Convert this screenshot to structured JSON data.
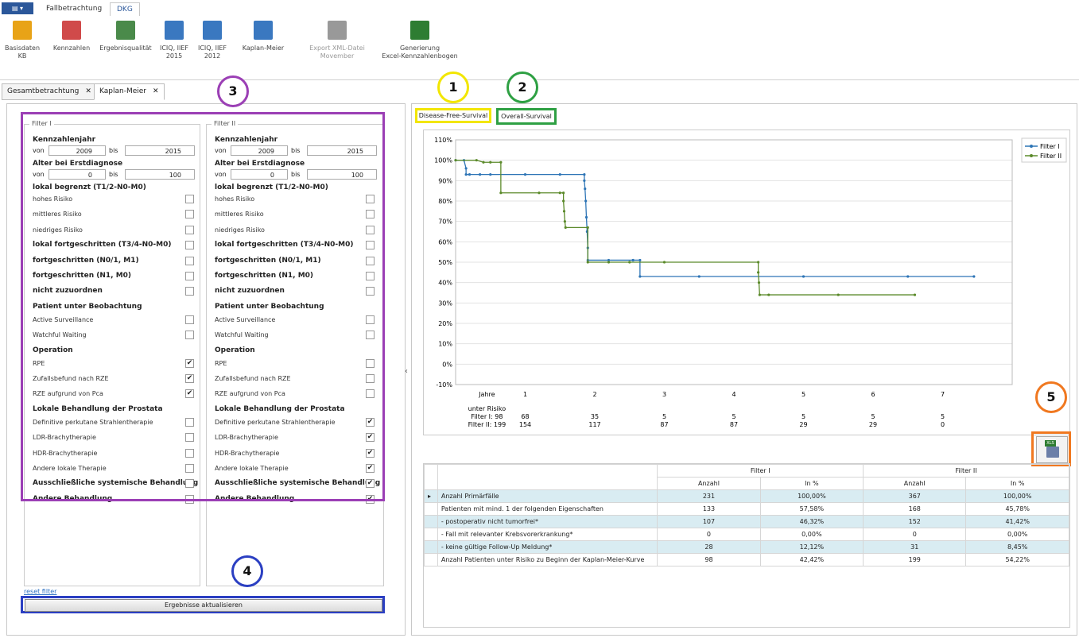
{
  "app": {
    "menu_button": "▤ ▾",
    "tabs": [
      "Fallbetrachtung",
      "DKG"
    ],
    "active_tab": "DKG"
  },
  "ribbon": {
    "buttons": [
      {
        "label": "Basisdaten\nKB",
        "icon": "database-icon",
        "color": "#e8a317"
      },
      {
        "label": "Kennzahlen",
        "icon": "grid-icon",
        "color": "#d04a4a"
      },
      {
        "label": "Ergebnisqualität",
        "icon": "checklist-icon",
        "color": "#4a8a4a"
      },
      {
        "label": "ICIQ, IIEF\n2015",
        "icon": "help-doc-icon",
        "color": "#3a78c0"
      },
      {
        "label": "ICIQ, IIEF\n2012",
        "icon": "help-doc-icon",
        "color": "#3a78c0"
      },
      {
        "label": "Kaplan-Meier",
        "icon": "line-chart-icon",
        "color": "#3a78c0"
      },
      {
        "label": "Export XML-Datei\nMovember",
        "icon": "xml-save-icon",
        "color": "#999999"
      },
      {
        "label": "Generierung\nExcel-Kennzahlenbogen",
        "icon": "excel-save-icon",
        "color": "#2e7d32"
      }
    ]
  },
  "doc_tabs": [
    {
      "label": "Gesamtbetrachtung",
      "close": "✕"
    },
    {
      "label": "Kaplan-Meier",
      "close": "✕"
    }
  ],
  "filters": {
    "filter1": {
      "legend": "Filter I",
      "year_from": "2009",
      "year_to": "2015",
      "age_from": "0",
      "age_to": "100",
      "checks": [
        false,
        false,
        false,
        false,
        false,
        false,
        false,
        false,
        false,
        true,
        true,
        true,
        false,
        false,
        false,
        false,
        false,
        false
      ]
    },
    "filter2": {
      "legend": "Filter II",
      "year_from": "2009",
      "year_to": "2015",
      "age_from": "0",
      "age_to": "100",
      "checks": [
        false,
        false,
        false,
        false,
        false,
        false,
        false,
        false,
        false,
        false,
        false,
        false,
        true,
        true,
        true,
        true,
        true,
        true
      ]
    },
    "labels": {
      "kennzahlenjahr": "Kennzahlenjahr",
      "alter": "Alter bei Erstdiagnose",
      "von": "von",
      "bis": "bis",
      "lokal_begrenzt": "lokal begrenzt (T1/2-N0-M0)",
      "beobachtung": "Patient unter Beobachtung",
      "operation": "Operation",
      "lokale_behandlung": "Lokale Behandlung der Prostata"
    },
    "items": [
      {
        "label": "hohes Risiko",
        "bold": false
      },
      {
        "label": "mittleres Risiko",
        "bold": false
      },
      {
        "label": "niedriges Risiko",
        "bold": false
      },
      {
        "label": "lokal fortgeschritten (T3/4-N0-M0)",
        "bold": true
      },
      {
        "label": "fortgeschritten (N0/1, M1)",
        "bold": true
      },
      {
        "label": "fortgeschritten (N1, M0)",
        "bold": true
      },
      {
        "label": "nicht zuzuordnen",
        "bold": true
      },
      {
        "label": "Active Surveillance",
        "bold": false
      },
      {
        "label": "Watchful Waiting",
        "bold": false
      },
      {
        "label": "RPE",
        "bold": false
      },
      {
        "label": "Zufallsbefund nach RZE",
        "bold": false
      },
      {
        "label": "RZE aufgrund von Pca",
        "bold": false
      },
      {
        "label": "Definitive perkutane Strahlentherapie",
        "bold": false
      },
      {
        "label": "LDR-Brachytherapie",
        "bold": false
      },
      {
        "label": "HDR-Brachytherapie",
        "bold": false
      },
      {
        "label": "Andere lokale Therapie",
        "bold": false
      },
      {
        "label": "Ausschließliche systemische Behandlung",
        "bold": true
      },
      {
        "label": "Andere Behandlung",
        "bold": true
      }
    ],
    "reset_link": "reset filter",
    "update_button": "Ergebnisse aktualisieren",
    "check_glyph": "✔"
  },
  "annotations": [
    {
      "n": "1",
      "color": "#f2e600"
    },
    {
      "n": "2",
      "color": "#2ea043"
    },
    {
      "n": "3",
      "color": "#9b3fb5"
    },
    {
      "n": "4",
      "color": "#2b3fc2"
    },
    {
      "n": "5",
      "color": "#f07820"
    }
  ],
  "chart_tabs": [
    "Disease-Free-Survival",
    "Overall-Survival"
  ],
  "collapse_arrow": "‹",
  "chart_data": {
    "type": "line",
    "title": "",
    "xlabel": "Jahre",
    "ylabel": "",
    "xlim": [
      0,
      8
    ],
    "ylim": [
      -10,
      110
    ],
    "yticks": [
      "110%",
      "100%",
      "90%",
      "80%",
      "70%",
      "60%",
      "50%",
      "40%",
      "30%",
      "20%",
      "10%",
      "0%",
      "-10%"
    ],
    "xticks": [
      "1",
      "2",
      "3",
      "4",
      "5",
      "6",
      "7"
    ],
    "legend": "top-right",
    "series": [
      {
        "name": "Filter I",
        "color": "#2e75b6",
        "points": [
          [
            0,
            100
          ],
          [
            0.12,
            100
          ],
          [
            0.15,
            96
          ],
          [
            0.15,
            93
          ],
          [
            0.2,
            93
          ],
          [
            0.35,
            93
          ],
          [
            0.5,
            93
          ],
          [
            1.0,
            93
          ],
          [
            1.5,
            93
          ],
          [
            1.85,
            93
          ],
          [
            1.85,
            90
          ],
          [
            1.86,
            86
          ],
          [
            1.87,
            80
          ],
          [
            1.88,
            72
          ],
          [
            1.89,
            65
          ],
          [
            1.9,
            57
          ],
          [
            1.9,
            51
          ],
          [
            2.2,
            51
          ],
          [
            2.55,
            51
          ],
          [
            2.55,
            51
          ],
          [
            2.65,
            51
          ],
          [
            2.65,
            43
          ],
          [
            3.5,
            43
          ],
          [
            5.0,
            43
          ],
          [
            6.5,
            43
          ],
          [
            7.45,
            43
          ]
        ]
      },
      {
        "name": "Filter II",
        "color": "#5b8a2a",
        "points": [
          [
            0,
            100
          ],
          [
            0.3,
            100
          ],
          [
            0.4,
            99
          ],
          [
            0.5,
            99
          ],
          [
            0.65,
            99
          ],
          [
            0.65,
            84
          ],
          [
            1.2,
            84
          ],
          [
            1.5,
            84
          ],
          [
            1.55,
            84
          ],
          [
            1.55,
            80
          ],
          [
            1.56,
            75
          ],
          [
            1.57,
            70
          ],
          [
            1.58,
            67
          ],
          [
            1.9,
            67
          ],
          [
            1.9,
            50
          ],
          [
            2.2,
            50
          ],
          [
            2.5,
            50
          ],
          [
            3.0,
            50
          ],
          [
            4.35,
            50
          ],
          [
            4.35,
            45
          ],
          [
            4.36,
            40
          ],
          [
            4.37,
            34
          ],
          [
            4.5,
            34
          ],
          [
            5.5,
            34
          ],
          [
            6.6,
            34
          ]
        ]
      }
    ],
    "risk_table": {
      "title": "unter Risiko",
      "rows": [
        {
          "label": "Filter I: 98",
          "values": [
            "68",
            "35",
            "5",
            "5",
            "5",
            "5",
            "5"
          ]
        },
        {
          "label": "Filter II: 199",
          "values": [
            "154",
            "117",
            "87",
            "87",
            "29",
            "29",
            "0"
          ]
        }
      ]
    }
  },
  "results_table": {
    "group_headers": [
      "Filter I",
      "Filter II"
    ],
    "sub_headers": [
      "Anzahl",
      "In %",
      "Anzahl",
      "In %"
    ],
    "rows": [
      {
        "label": "Anzahl Primärfälle",
        "expander": "▸",
        "values": [
          "231",
          "100,00%",
          "367",
          "100,00%"
        ],
        "hl": true
      },
      {
        "label": "Patienten mit mind. 1 der folgenden Eigenschaften",
        "expander": "",
        "values": [
          "133",
          "57,58%",
          "168",
          "45,78%"
        ],
        "hl": false
      },
      {
        "label": "- postoperativ nicht tumorfrei*",
        "expander": "",
        "values": [
          "107",
          "46,32%",
          "152",
          "41,42%"
        ],
        "hl": true
      },
      {
        "label": "- Fall mit relevanter Krebsvorerkrankung*",
        "expander": "",
        "values": [
          "0",
          "0,00%",
          "0",
          "0,00%"
        ],
        "hl": false
      },
      {
        "label": "- keine gültige Follow-Up Meldung*",
        "expander": "",
        "values": [
          "28",
          "12,12%",
          "31",
          "8,45%"
        ],
        "hl": true
      },
      {
        "label": "Anzahl Patienten unter Risiko zu Beginn der Kaplan-Meier-Kurve",
        "expander": "",
        "values": [
          "98",
          "42,42%",
          "199",
          "54,22%"
        ],
        "hl": false
      }
    ]
  },
  "excel_button": "XLS"
}
